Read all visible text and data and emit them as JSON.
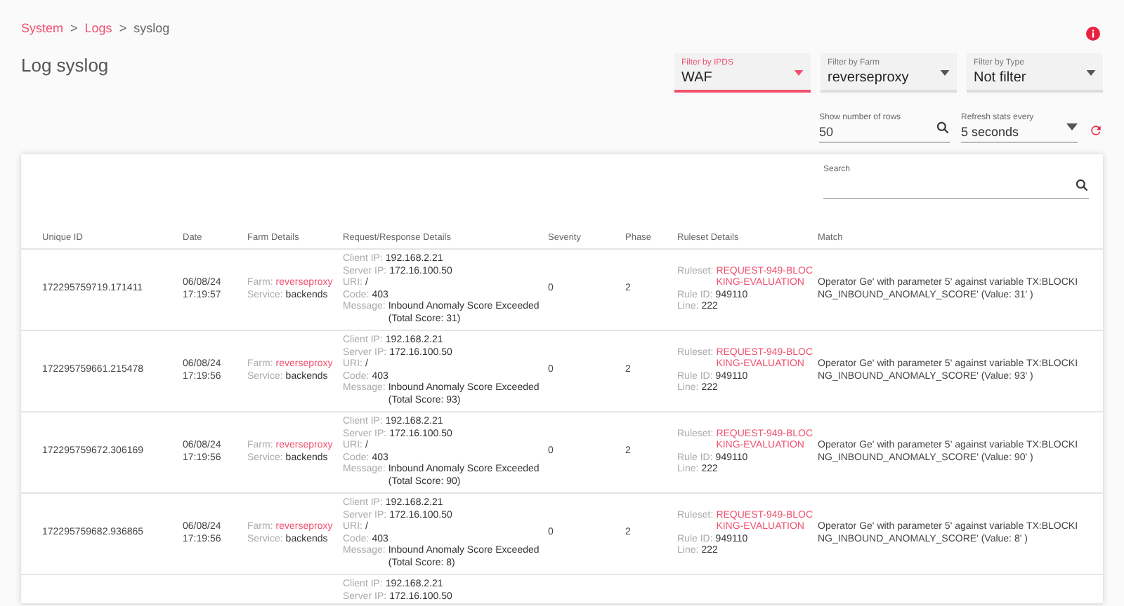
{
  "breadcrumb": [
    {
      "label": "System",
      "kind": "link"
    },
    {
      "label": ">",
      "kind": "separator"
    },
    {
      "label": "Logs",
      "kind": "link"
    },
    {
      "label": ">",
      "kind": "separator"
    },
    {
      "label": "syslog",
      "kind": "current"
    }
  ],
  "title": "Log syslog",
  "filters": [
    {
      "label": "Filter by IPDS",
      "value": "WAF",
      "focused": true
    },
    {
      "label": "Filter by Farm",
      "value": "reverseproxy",
      "focused": false
    },
    {
      "label": "Filter by Type",
      "value": "Not filter",
      "focused": false
    }
  ],
  "rows_field": {
    "label": "Show number of rows",
    "value": "50"
  },
  "refresh_select": {
    "label": "Refresh stats every",
    "value": "5 seconds"
  },
  "search": {
    "label": "Search"
  },
  "table": {
    "columns": [
      "Unique ID",
      "Date",
      "Farm Details",
      "Request/Response Details",
      "Severity",
      "Phase",
      "Ruleset Details",
      "Match"
    ],
    "rows": [
      {
        "unique_id": "172295759719.171411",
        "date": "06/08/24 17:19:57",
        "farm": [
          {
            "label": "Farm:",
            "value": "reverseproxy",
            "kind": "link"
          },
          {
            "label": "Service:",
            "value": "backends",
            "kind": "plain"
          }
        ],
        "request": [
          {
            "label": "Client IP:",
            "value": "192.168.2.21"
          },
          {
            "label": "Server IP:",
            "value": "172.16.100.50"
          },
          {
            "label": "URI:",
            "value": "/"
          },
          {
            "label": "Code:",
            "value": "403"
          },
          {
            "label": "Message:",
            "value": "Inbound Anomaly Score Exceeded (Total Score: 31)"
          }
        ],
        "severity": "0",
        "phase": "2",
        "ruleset": [
          {
            "label": "Ruleset:",
            "value": "REQUEST-949-BLOCKING-EVALUATION",
            "kind": "link"
          },
          {
            "label": "Rule ID:",
            "value": "949110",
            "kind": "plain"
          },
          {
            "label": "Line:",
            "value": "222",
            "kind": "plain"
          }
        ],
        "match": "Operator Ge' with parameter 5' against variable TX:BLOCKING_INBOUND_ANOMALY_SCORE' (Value: 31' )"
      },
      {
        "unique_id": "172295759661.215478",
        "date": "06/08/24 17:19:56",
        "farm": [
          {
            "label": "Farm:",
            "value": "reverseproxy",
            "kind": "link"
          },
          {
            "label": "Service:",
            "value": "backends",
            "kind": "plain"
          }
        ],
        "request": [
          {
            "label": "Client IP:",
            "value": "192.168.2.21"
          },
          {
            "label": "Server IP:",
            "value": "172.16.100.50"
          },
          {
            "label": "URI:",
            "value": "/"
          },
          {
            "label": "Code:",
            "value": "403"
          },
          {
            "label": "Message:",
            "value": "Inbound Anomaly Score Exceeded (Total Score: 93)"
          }
        ],
        "severity": "0",
        "phase": "2",
        "ruleset": [
          {
            "label": "Ruleset:",
            "value": "REQUEST-949-BLOCKING-EVALUATION",
            "kind": "link"
          },
          {
            "label": "Rule ID:",
            "value": "949110",
            "kind": "plain"
          },
          {
            "label": "Line:",
            "value": "222",
            "kind": "plain"
          }
        ],
        "match": "Operator Ge' with parameter 5' against variable TX:BLOCKING_INBOUND_ANOMALY_SCORE' (Value: 93' )"
      },
      {
        "unique_id": "172295759672.306169",
        "date": "06/08/24 17:19:56",
        "farm": [
          {
            "label": "Farm:",
            "value": "reverseproxy",
            "kind": "link"
          },
          {
            "label": "Service:",
            "value": "backends",
            "kind": "plain"
          }
        ],
        "request": [
          {
            "label": "Client IP:",
            "value": "192.168.2.21"
          },
          {
            "label": "Server IP:",
            "value": "172.16.100.50"
          },
          {
            "label": "URI:",
            "value": "/"
          },
          {
            "label": "Code:",
            "value": "403"
          },
          {
            "label": "Message:",
            "value": "Inbound Anomaly Score Exceeded (Total Score: 90)"
          }
        ],
        "severity": "0",
        "phase": "2",
        "ruleset": [
          {
            "label": "Ruleset:",
            "value": "REQUEST-949-BLOCKING-EVALUATION",
            "kind": "link"
          },
          {
            "label": "Rule ID:",
            "value": "949110",
            "kind": "plain"
          },
          {
            "label": "Line:",
            "value": "222",
            "kind": "plain"
          }
        ],
        "match": "Operator Ge' with parameter 5' against variable TX:BLOCKING_INBOUND_ANOMALY_SCORE' (Value: 90' )"
      },
      {
        "unique_id": "172295759682.936865",
        "date": "06/08/24 17:19:56",
        "farm": [
          {
            "label": "Farm:",
            "value": "reverseproxy",
            "kind": "link"
          },
          {
            "label": "Service:",
            "value": "backends",
            "kind": "plain"
          }
        ],
        "request": [
          {
            "label": "Client IP:",
            "value": "192.168.2.21"
          },
          {
            "label": "Server IP:",
            "value": "172.16.100.50"
          },
          {
            "label": "URI:",
            "value": "/"
          },
          {
            "label": "Code:",
            "value": "403"
          },
          {
            "label": "Message:",
            "value": "Inbound Anomaly Score Exceeded (Total Score: 8)"
          }
        ],
        "severity": "0",
        "phase": "2",
        "ruleset": [
          {
            "label": "Ruleset:",
            "value": "REQUEST-949-BLOCKING-EVALUATION",
            "kind": "link"
          },
          {
            "label": "Rule ID:",
            "value": "949110",
            "kind": "plain"
          },
          {
            "label": "Line:",
            "value": "222",
            "kind": "plain"
          }
        ],
        "match": "Operator Ge' with parameter 5' against variable TX:BLOCKING_INBOUND_ANOMALY_SCORE' (Value: 8' )"
      },
      {
        "request": [
          {
            "label": "Client IP:",
            "value": "192.168.2.21"
          },
          {
            "label": "Server IP:",
            "value": "172.16.100.50"
          }
        ]
      }
    ]
  }
}
